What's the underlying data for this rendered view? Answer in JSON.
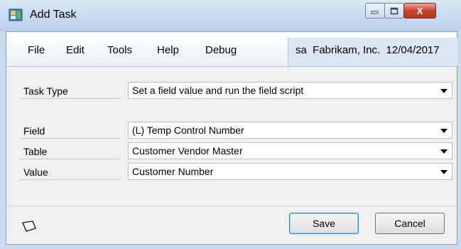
{
  "window": {
    "title": "Add Task",
    "close_glyph": "X"
  },
  "menu": {
    "items": [
      "File",
      "Edit",
      "Tools",
      "Help",
      "Debug"
    ]
  },
  "status": {
    "company_info": "sa  Fabrikam, Inc.  12/04/2017"
  },
  "form": {
    "task_type": {
      "label": "Task Type",
      "value": "Set a field value and run the field script"
    },
    "field": {
      "label": "Field",
      "value": "(L) Temp Control Number"
    },
    "table": {
      "label": "Table",
      "value": "Customer Vendor Master"
    },
    "value": {
      "label": "Value",
      "value": "Customer Number"
    }
  },
  "buttons": {
    "save": "Save",
    "cancel": "Cancel"
  },
  "icons": {
    "app": "app-icon",
    "note": "note-icon",
    "dropdown": "chevron-down-icon"
  }
}
